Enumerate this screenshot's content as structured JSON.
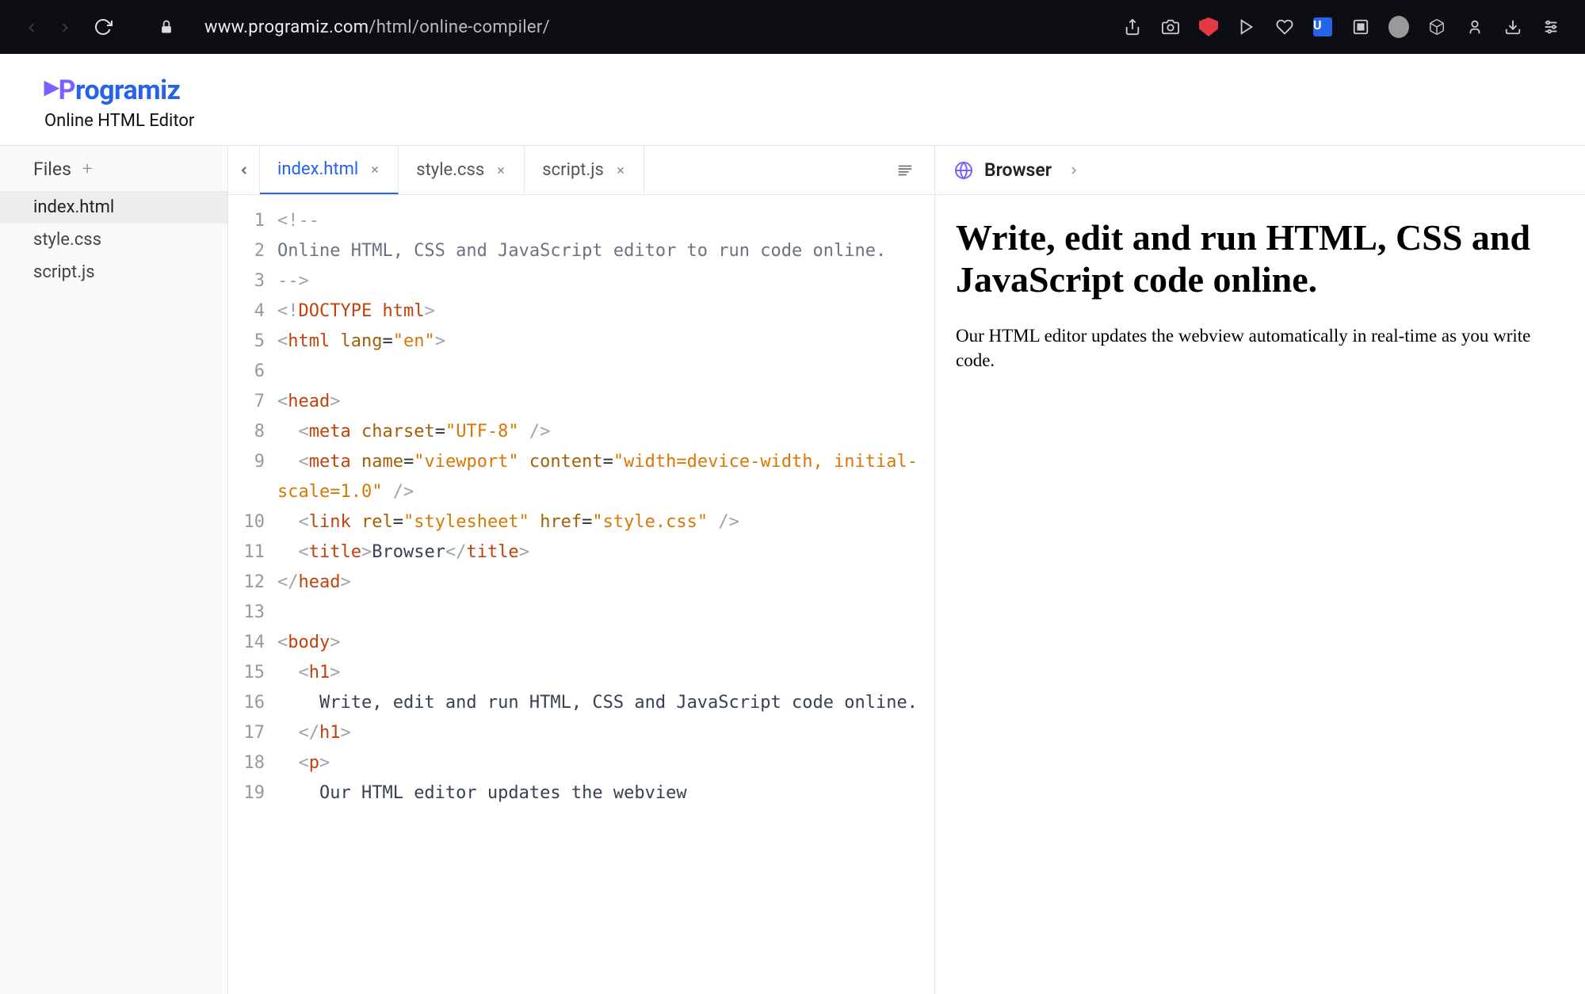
{
  "browser": {
    "url_domain": "www.programiz.com",
    "url_path": "/html/online-compiler/"
  },
  "header": {
    "brand_first": "P",
    "brand_rest": "rogramiz",
    "subtitle": "Online HTML Editor"
  },
  "sidebar": {
    "title": "Files",
    "files": [
      "index.html",
      "style.css",
      "script.js"
    ],
    "active": 0
  },
  "tabs": [
    {
      "label": "index.html",
      "active": true
    },
    {
      "label": "style.css",
      "active": false
    },
    {
      "label": "script.js",
      "active": false
    }
  ],
  "editor": {
    "lines": [
      {
        "n": 1,
        "html": "<span class='ang'>&lt;!--</span>"
      },
      {
        "n": 2,
        "html": "<span class='cm'>Online HTML, CSS and JavaScript editor to run code online.</span>"
      },
      {
        "n": 3,
        "html": "<span class='ang'>--&gt;</span>"
      },
      {
        "n": 4,
        "html": "<span class='ang'>&lt;!</span><span class='tag'>DOCTYPE html</span><span class='ang'>&gt;</span>"
      },
      {
        "n": 5,
        "html": "<span class='ang'>&lt;</span><span class='tag'>html</span> <span class='attr'>lang</span>=<span class='str'>\"en\"</span><span class='ang'>&gt;</span>"
      },
      {
        "n": 6,
        "html": ""
      },
      {
        "n": 7,
        "html": "<span class='ang'>&lt;</span><span class='tag'>head</span><span class='ang'>&gt;</span>"
      },
      {
        "n": 8,
        "html": "  <span class='ang'>&lt;</span><span class='tag'>meta</span> <span class='attr'>charset</span>=<span class='str'>\"UTF-8\"</span> <span class='ang'>/&gt;</span>"
      },
      {
        "n": 9,
        "html": "  <span class='ang'>&lt;</span><span class='tag'>meta</span> <span class='attr'>name</span>=<span class='str'>\"viewport\"</span> <span class='attr'>content</span>=<span class='str'>\"width=device-width, initial-scale=1.0\"</span> <span class='ang'>/&gt;</span>"
      },
      {
        "n": 10,
        "html": "  <span class='ang'>&lt;</span><span class='tag'>link</span> <span class='attr'>rel</span>=<span class='str'>\"stylesheet\"</span> <span class='attr'>href</span>=<span class='str'>\"style.css\"</span> <span class='ang'>/&gt;</span>"
      },
      {
        "n": 11,
        "html": "  <span class='ang'>&lt;</span><span class='tag'>title</span><span class='ang'>&gt;</span><span class='txt'>Browser</span><span class='ang'>&lt;/</span><span class='tag'>title</span><span class='ang'>&gt;</span>"
      },
      {
        "n": 12,
        "html": "<span class='ang'>&lt;/</span><span class='tag'>head</span><span class='ang'>&gt;</span>"
      },
      {
        "n": 13,
        "html": ""
      },
      {
        "n": 14,
        "html": "<span class='ang'>&lt;</span><span class='tag'>body</span><span class='ang'>&gt;</span>"
      },
      {
        "n": 15,
        "html": "  <span class='ang'>&lt;</span><span class='tag'>h1</span><span class='ang'>&gt;</span>"
      },
      {
        "n": 16,
        "html": "    <span class='txt'>Write, edit and run HTML, CSS and JavaScript code online.</span>"
      },
      {
        "n": 17,
        "html": "  <span class='ang'>&lt;/</span><span class='tag'>h1</span><span class='ang'>&gt;</span>"
      },
      {
        "n": 18,
        "html": "  <span class='ang'>&lt;</span><span class='tag'>p</span><span class='ang'>&gt;</span>"
      },
      {
        "n": 19,
        "html": "    <span class='txt'>Our HTML editor updates the webview</span>"
      }
    ]
  },
  "preview": {
    "title": "Browser",
    "h1": "Write, edit and run HTML, CSS and JavaScript code online.",
    "p": "Our HTML editor updates the webview automatically in real-time as you write code."
  }
}
